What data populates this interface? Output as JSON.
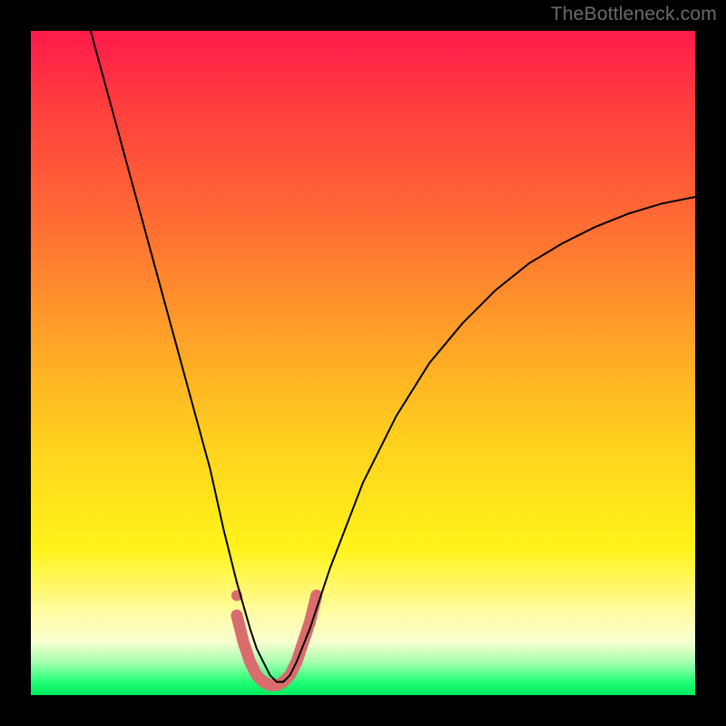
{
  "watermark": "TheBottleneck.com",
  "chart_data": {
    "type": "line",
    "title": "",
    "xlabel": "",
    "ylabel": "",
    "xlim": [
      0,
      100
    ],
    "ylim": [
      0,
      100
    ],
    "series": [
      {
        "name": "bottleneck-curve",
        "color": "#000000",
        "stroke_width": 2,
        "x": [
          9,
          12,
          15,
          18,
          21,
          24,
          27,
          29,
          31,
          33,
          34,
          35,
          36,
          37,
          38,
          39,
          40,
          42,
          45,
          50,
          55,
          60,
          65,
          70,
          75,
          80,
          85,
          90,
          95,
          100
        ],
        "y": [
          100,
          89,
          78,
          67,
          56,
          45,
          34,
          25,
          17,
          10,
          7,
          5,
          3,
          2,
          2,
          3,
          5,
          10,
          19,
          32,
          42,
          50,
          56,
          61,
          65,
          68,
          70.5,
          72.5,
          74,
          75
        ]
      },
      {
        "name": "highlight-band",
        "color": "#d96d6e",
        "stroke_width": 13,
        "x": [
          31,
          32,
          33,
          34,
          35,
          36,
          37,
          38,
          39,
          40,
          41,
          42,
          43
        ],
        "y": [
          12,
          8,
          5,
          3,
          2,
          1.5,
          1.5,
          2,
          3,
          5,
          8,
          11,
          15
        ]
      },
      {
        "name": "highlight-dot",
        "color": "#d96d6e",
        "type": "scatter",
        "radius": 6,
        "x": [
          31
        ],
        "y": [
          15
        ]
      }
    ]
  }
}
